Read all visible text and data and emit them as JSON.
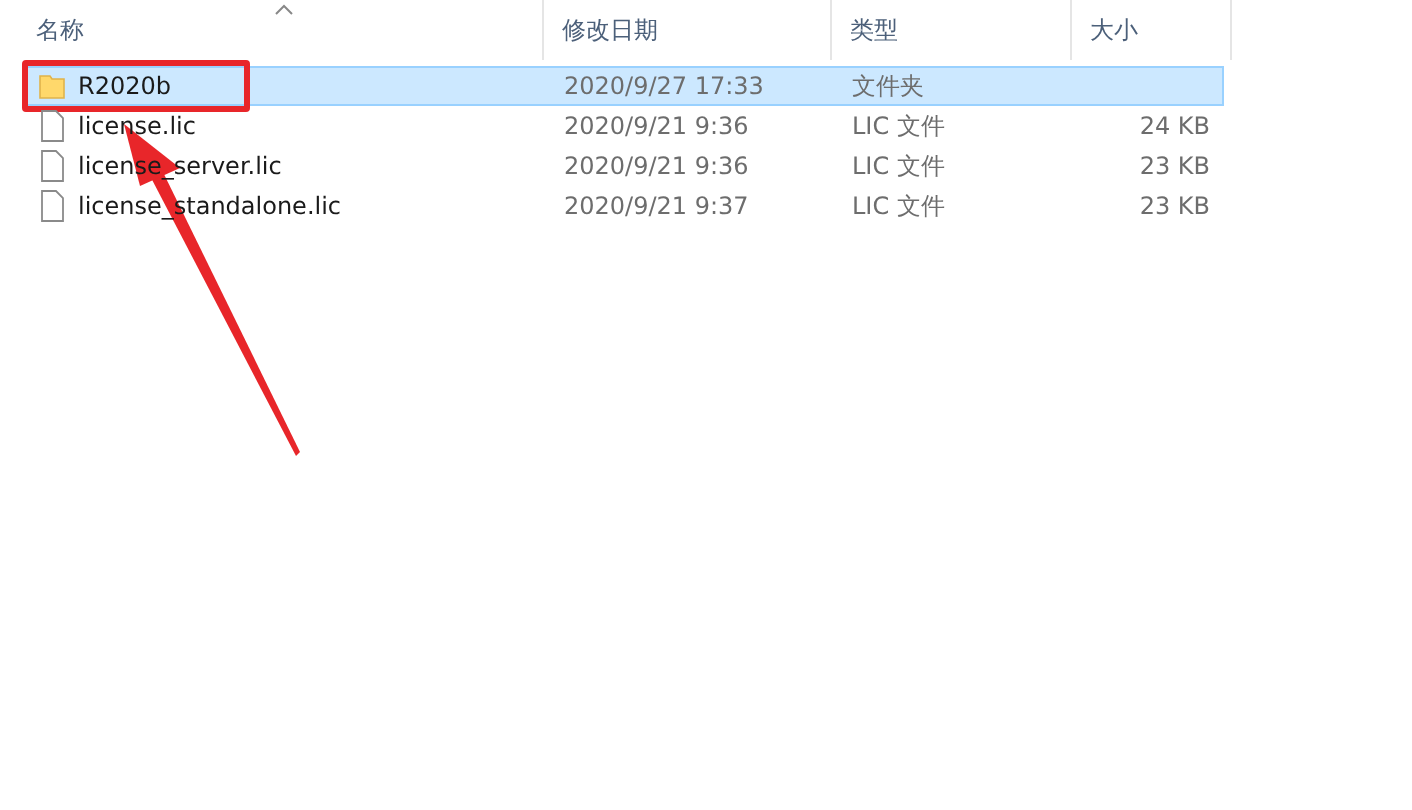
{
  "columns": [
    {
      "label": "名称",
      "sorted": true
    },
    {
      "label": "修改日期",
      "sorted": false
    },
    {
      "label": "类型",
      "sorted": false
    },
    {
      "label": "大小",
      "sorted": false
    }
  ],
  "rows": [
    {
      "kind": "folder",
      "name": "R2020b",
      "date": "2020/9/27 17:33",
      "type": "文件夹",
      "size": "",
      "selected": true,
      "highlighted": true
    },
    {
      "kind": "file",
      "name": "license.lic",
      "date": "2020/9/21 9:36",
      "type": "LIC 文件",
      "size": "24 KB",
      "selected": false,
      "highlighted": false
    },
    {
      "kind": "file",
      "name": "license_server.lic",
      "date": "2020/9/21 9:36",
      "type": "LIC 文件",
      "size": "23 KB",
      "selected": false,
      "highlighted": false
    },
    {
      "kind": "file",
      "name": "license_standalone.lic",
      "date": "2020/9/21 9:37",
      "type": "LIC 文件",
      "size": "23 KB",
      "selected": false,
      "highlighted": false
    }
  ]
}
